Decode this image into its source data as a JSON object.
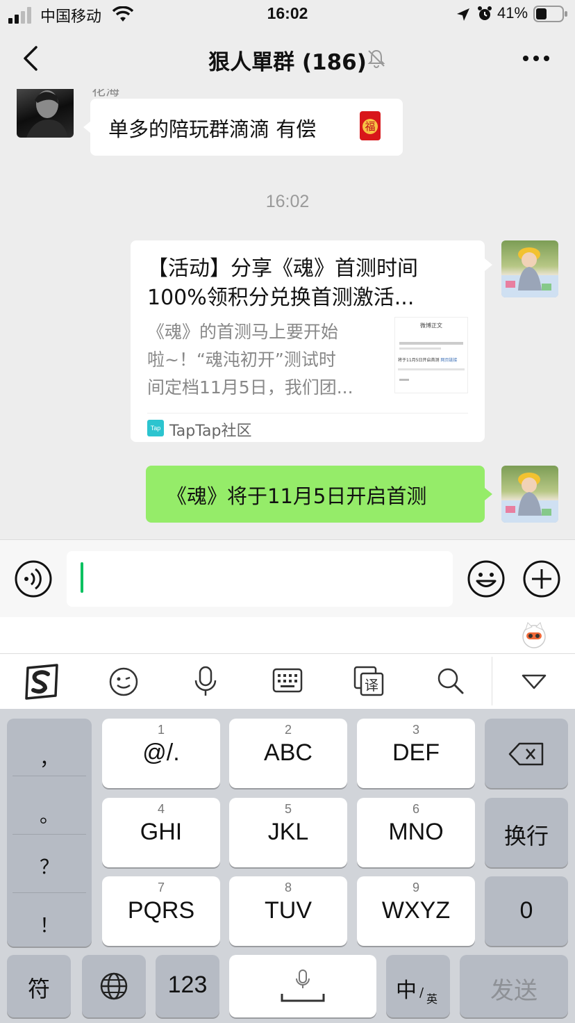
{
  "status_bar": {
    "carrier": "中国移动",
    "time": "16:02",
    "battery": "41%"
  },
  "nav": {
    "title": "狠人單群 (186)",
    "icons": [
      "back-arrow-icon",
      "mute-bell-icon",
      "more-icon"
    ]
  },
  "chat": {
    "sender_name_partial": "花海",
    "msg1_text": "单多的陪玩群滴滴 有偿",
    "msg1_emoji": "福",
    "timestamp": "16:02",
    "link_card": {
      "title_line1": "【活动】分享《魂》首测时间",
      "title_line2": "100%领积分兑换首测激活...",
      "desc_line1": "《魂》的首测马上要开始",
      "desc_line2": "啦~！“魂沌初开”测试时",
      "desc_line3": "间定档11月5日，我们团...",
      "thumb_title": "微博正文",
      "thumb_line1": "将于11月5日开启首测",
      "thumb_link": "网页链接",
      "source_icon": "Tap",
      "source": "TapTap社区"
    },
    "msg3_text": "《魂》将于11月5日开启首测"
  },
  "keyboard": {
    "punct": [
      "，",
      "。",
      "？",
      "！"
    ],
    "keys": [
      {
        "num": "1",
        "label": "@/."
      },
      {
        "num": "2",
        "label": "ABC"
      },
      {
        "num": "3",
        "label": "DEF"
      },
      {
        "num": "4",
        "label": "GHI"
      },
      {
        "num": "5",
        "label": "JKL"
      },
      {
        "num": "6",
        "label": "MNO"
      },
      {
        "num": "7",
        "label": "PQRS"
      },
      {
        "num": "8",
        "label": "TUV"
      },
      {
        "num": "9",
        "label": "WXYZ"
      }
    ],
    "newline": "换行",
    "zero": "0",
    "symbols": "符",
    "numbers": "123",
    "lang_main": "中",
    "lang_sep": "/",
    "lang_sub": "英",
    "send": "发送"
  },
  "colors": {
    "bubble_green": "#95ec69",
    "chat_bg": "#ededed",
    "caret": "#07c160",
    "send_text": "#8e9196"
  }
}
